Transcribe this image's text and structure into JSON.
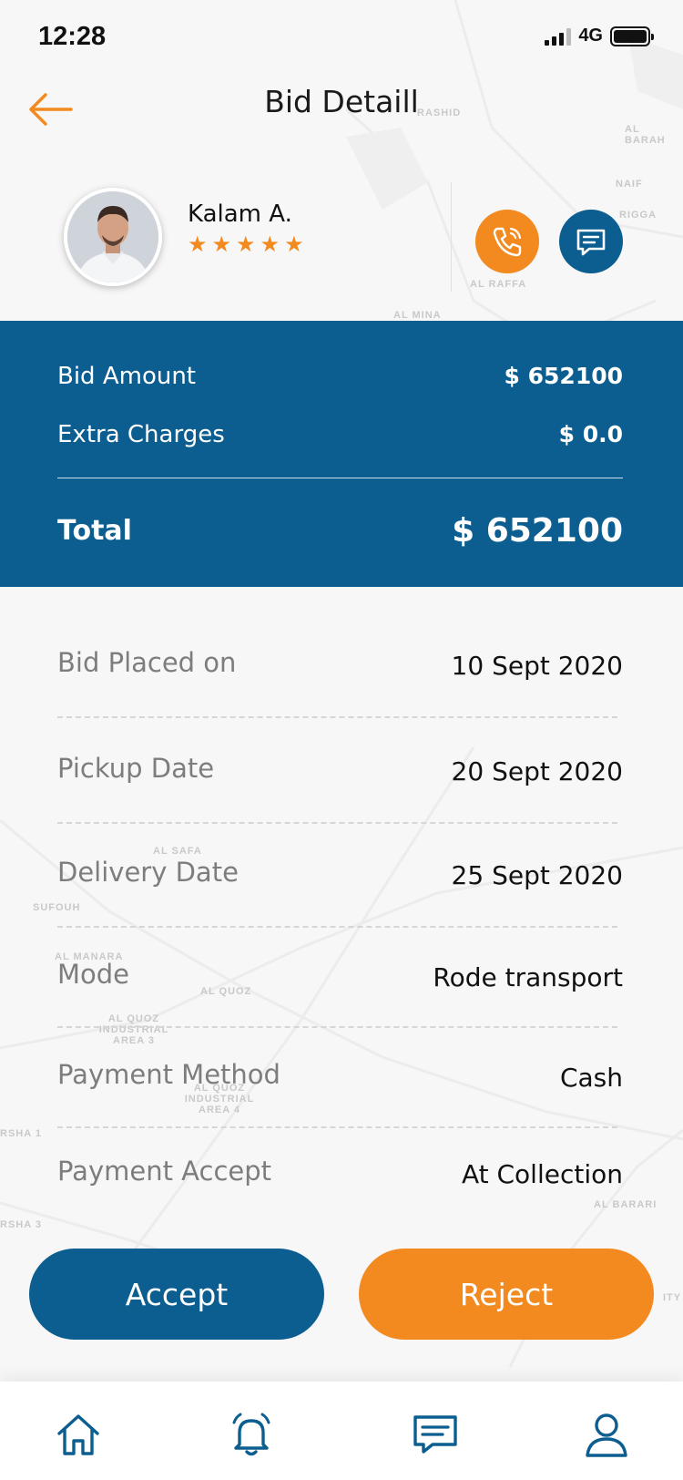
{
  "status_bar": {
    "time": "12:28",
    "network": "4G"
  },
  "header": {
    "title": "Bid Detaill"
  },
  "profile": {
    "name": "Kalam A.",
    "rating": 5,
    "stars": [
      "★",
      "★",
      "★",
      "★",
      "★"
    ]
  },
  "amounts": {
    "bid_amount_label": "Bid Amount",
    "bid_amount_value": "$ 652100",
    "extra_charges_label": "Extra Charges",
    "extra_charges_value": "$ 0.0",
    "total_label": "Total",
    "total_value": "$ 652100"
  },
  "details": [
    {
      "label": "Bid Placed on",
      "value": "10 Sept 2020"
    },
    {
      "label": "Pickup Date",
      "value": "20 Sept 2020"
    },
    {
      "label": "Delivery Date",
      "value": "25 Sept 2020"
    },
    {
      "label": "Mode",
      "value": "Rode transport"
    },
    {
      "label": "Payment Method",
      "value": "Cash"
    },
    {
      "label": "Payment Accept",
      "value": "At Collection"
    }
  ],
  "actions": {
    "accept_label": "Accept",
    "reject_label": "Reject"
  },
  "bottom_nav": [
    {
      "icon": "home-icon"
    },
    {
      "icon": "bell-icon"
    },
    {
      "icon": "chat-icon"
    },
    {
      "icon": "user-icon"
    }
  ],
  "map_labels": [
    "RASHID",
    "AL BARAH",
    "NAIF",
    "RIGGA",
    "AL RAFFA",
    "AL MINA",
    "AL QUOZ",
    "AL MANARA",
    "AL QUOZ INDUSTRIAL AREA 3",
    "AL QUOZ INDUSTRIAL AREA 4",
    "AL BARARI",
    "RSHA 1",
    "RSHA 3",
    "SUFOUH",
    "AL SAFA",
    "ITY"
  ],
  "colors": {
    "primary_blue": "#0b5e8f",
    "accent_orange": "#f28a1f"
  }
}
